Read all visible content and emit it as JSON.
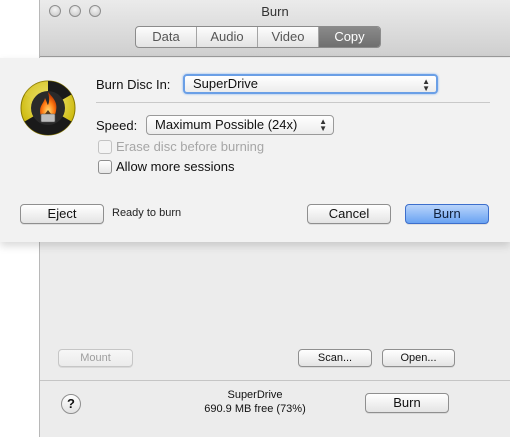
{
  "window": {
    "title": "Burn",
    "tabs": [
      {
        "label": "Data",
        "selected": false
      },
      {
        "label": "Audio",
        "selected": false
      },
      {
        "label": "Video",
        "selected": false
      },
      {
        "label": "Copy",
        "selected": true
      }
    ],
    "buttons": {
      "mount": "Mount",
      "scan": "Scan...",
      "open": "Open..."
    },
    "footer": {
      "drive_name": "SuperDrive",
      "drive_free": "690.9 MB free (73%)",
      "burn_label": "Burn",
      "help_label": "?"
    }
  },
  "sheet": {
    "burn_disc_label": "Burn Disc In:",
    "burn_disc_value": "SuperDrive",
    "speed_label": "Speed:",
    "speed_value": "Maximum Possible (24x)",
    "erase_label": "Erase disc before burning",
    "erase_checked": false,
    "erase_enabled": false,
    "allow_sessions_label": "Allow more sessions",
    "allow_sessions_checked": false,
    "eject_label": "Eject",
    "status_text": "Ready to burn",
    "cancel_label": "Cancel",
    "burn_label": "Burn"
  },
  "colors": {
    "accent": "#6aa3f2",
    "selected_tab": "#777777"
  }
}
